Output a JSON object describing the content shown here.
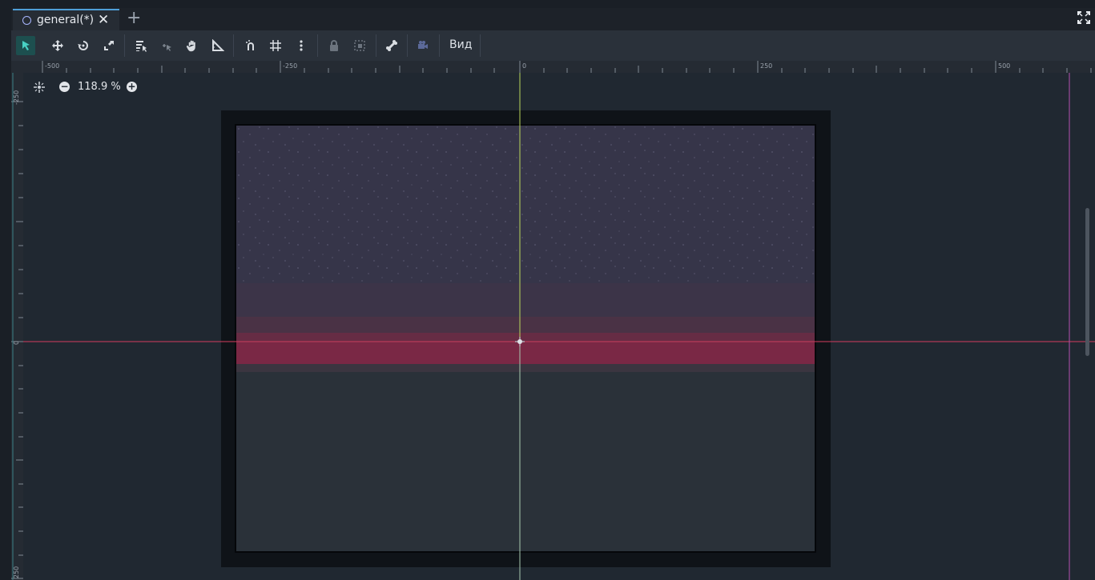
{
  "tab": {
    "title": "general(*)",
    "close": "✕",
    "add": "+"
  },
  "toolbar": {
    "view_menu": "Вид"
  },
  "zoom": {
    "value": "118.9 %",
    "minus": "−",
    "plus": "+"
  },
  "ruler": {
    "h_labels": [
      "-500",
      "-250",
      "0",
      "250",
      "500"
    ],
    "v_labels": [
      "-250",
      "0",
      "250"
    ]
  },
  "colors": {
    "accent": "#4f9fd8",
    "sky": "#363549",
    "horizon_red": "#7a2845",
    "ground": "#2a3139",
    "axis_x": "#d43c5e",
    "axis_y": "#b9d65a",
    "viewport_bg": "#202831"
  },
  "icons": {
    "select": "select-arrow-icon",
    "move": "move-icon",
    "rotate": "rotate-icon",
    "scale": "scale-icon",
    "list_select": "list-select-icon",
    "pivot": "pivot-icon",
    "pan": "hand-pan-icon",
    "ruler": "ruler-icon",
    "smart_snap": "smart-snap-icon",
    "grid_snap": "grid-snap-icon",
    "more": "kebab-menu-icon",
    "lock": "lock-icon",
    "group": "group-icon",
    "bones": "bone-icon",
    "camera": "camera-override-icon"
  }
}
